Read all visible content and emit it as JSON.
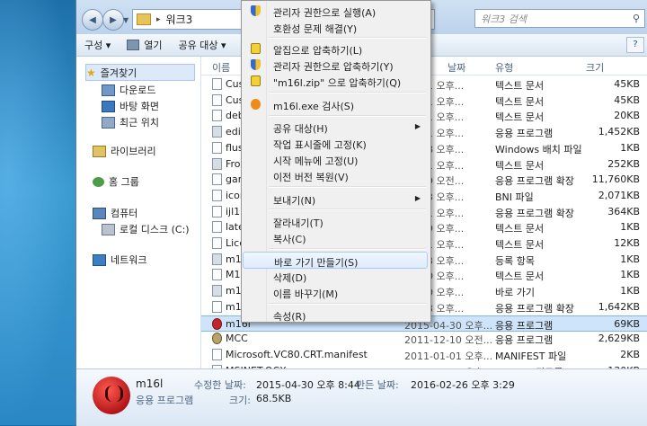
{
  "address": {
    "path": "워크3",
    "search_placeholder": "워크3 검색"
  },
  "toolbar": {
    "organize": "구성 ▾",
    "open": "열기",
    "share": "공유 대상 ▾"
  },
  "nav": {
    "favorites": "즐겨찾기",
    "downloads": "다운로드",
    "desktop": "바탕 화면",
    "recent": "최근 위치",
    "libraries": "라이브러리",
    "homegroup": "홈 그룹",
    "computer": "컴퓨터",
    "local_disk": "로컬 디스크 (C:)",
    "network": "네트워크"
  },
  "columns": {
    "name": "이름",
    "date": "날짜",
    "type": "유형",
    "size": "크기"
  },
  "files": [
    {
      "name": "Cust",
      "date": "01-01 오후...",
      "type": "텍스트 문서",
      "size": "45KB"
    },
    {
      "name": "Cust",
      "date": "01-01 오후...",
      "type": "텍스트 문서",
      "size": "45KB"
    },
    {
      "name": "debu",
      "date": "01-01 오후...",
      "type": "텍스트 문서",
      "size": "20KB"
    },
    {
      "name": "edito",
      "date": "01-01 오후...",
      "type": "응용 프로그램",
      "size": "1,452KB"
    },
    {
      "name": "flush",
      "date": "11-28 오후...",
      "type": "Windows 배치 파일",
      "size": "1KB"
    },
    {
      "name": "Froze",
      "date": "01-01 오후...",
      "type": "텍스트 문서",
      "size": "252KB"
    },
    {
      "name": "gam",
      "date": "03-19 오전...",
      "type": "응용 프로그램 확장",
      "size": "11,760KB"
    },
    {
      "name": "icons",
      "date": "02-13 오후...",
      "type": "BNI 파일",
      "size": "2,071KB"
    },
    {
      "name": "ijl15.",
      "date": "01-01 오후...",
      "type": "응용 프로그램 확장",
      "size": "364KB"
    },
    {
      "name": "laten",
      "date": "03-09 오후...",
      "type": "텍스트 문서",
      "size": "1KB"
    },
    {
      "name": "Licen",
      "date": "01-01 오후...",
      "type": "텍스트 문서",
      "size": "12KB"
    },
    {
      "name": "m16",
      "date": "05-03 오후...",
      "type": "등록 항목",
      "size": "1KB"
    },
    {
      "name": "M16",
      "date": "04-30 오후...",
      "type": "텍스트 문서",
      "size": "1KB"
    },
    {
      "name": "m16",
      "date": "03-10 오후...",
      "type": "바로 가기",
      "size": "1KB"
    },
    {
      "name": "m16",
      "date": "10-23 오후...",
      "type": "응용 프로그램 확장",
      "size": "1,642KB"
    },
    {
      "name": "m16l",
      "date": "2015-04-30 오후...",
      "type": "응용 프로그램",
      "size": "69KB"
    },
    {
      "name": "MCC",
      "date": "2011-12-10 오전...",
      "type": "응용 프로그램",
      "size": "2,629KB"
    },
    {
      "name": "Microsoft.VC80.CRT.manifest",
      "date": "2011-01-01 오후...",
      "type": "MANIFEST 파일",
      "size": "2KB"
    },
    {
      "name": "MSINET.OCX",
      "date": "2011-11-28 오후...",
      "type": "ActiveX 컨트롤",
      "size": "130KB"
    }
  ],
  "details": {
    "name": "m16l",
    "kind": "응용 프로그램",
    "modified_label": "수정한 날짜:",
    "modified": "2015-04-30 오후 8:44",
    "created_label": "만든 날짜:",
    "created": "2016-02-26 오후 3:29",
    "size_label": "크기:",
    "size": "68.5KB"
  },
  "menu": [
    {
      "label": "관리자 권한으로 실행(A)",
      "icon": "shield-icon"
    },
    {
      "label": "호환성 문제 해결(Y)",
      "icon": ""
    },
    {
      "label": "알집으로 압축하기(L)",
      "icon": "alzip-icon"
    },
    {
      "label": "관리자 권한으로 압축하기(Y)",
      "icon": "shield-icon"
    },
    {
      "label": "\"m16l.zip\" 으로 압축하기(Q)",
      "icon": "alzip-icon"
    },
    {
      "label": "m16l.exe 검사(S)",
      "icon": "virus-scan-icon"
    },
    {
      "label": "공유 대상(H)",
      "icon": "",
      "submenu": true
    },
    {
      "label": "작업 표시줄에 고정(K)",
      "icon": ""
    },
    {
      "label": "시작 메뉴에 고정(U)",
      "icon": ""
    },
    {
      "label": "이전 버전 복원(V)",
      "icon": ""
    },
    {
      "label": "보내기(N)",
      "icon": "",
      "submenu": true
    },
    {
      "label": "잘라내기(T)",
      "icon": ""
    },
    {
      "label": "복사(C)",
      "icon": ""
    },
    {
      "label": "바로 가기 만들기(S)",
      "icon": "",
      "highlighted": true
    },
    {
      "label": "삭제(D)",
      "icon": ""
    },
    {
      "label": "이름 바꾸기(M)",
      "icon": ""
    },
    {
      "label": "속성(R)",
      "icon": ""
    }
  ]
}
